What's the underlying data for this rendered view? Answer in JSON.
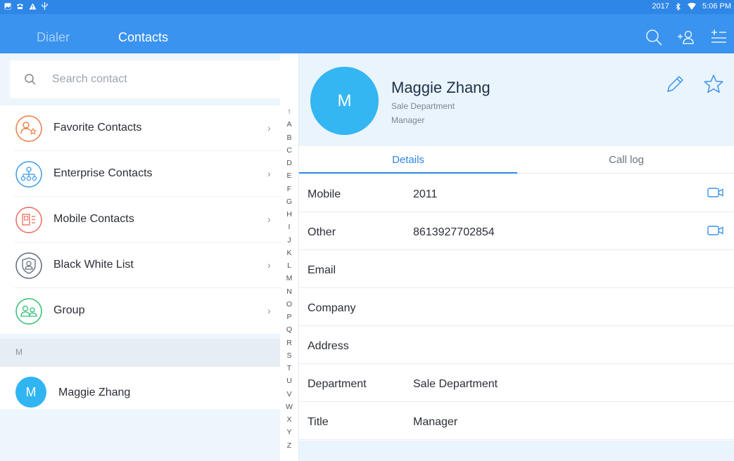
{
  "status_bar": {
    "left_icons": [
      "image-icon",
      "phone-icon",
      "warning-icon",
      "usb-icon"
    ],
    "year": "2017",
    "time": "5:06 PM"
  },
  "app_bar": {
    "tabs": [
      {
        "label": "Dialer",
        "active": false
      },
      {
        "label": "Contacts",
        "active": true
      }
    ],
    "icons": [
      "search-icon",
      "add-contact-icon",
      "menu-add-icon"
    ]
  },
  "search": {
    "placeholder": "Search contact"
  },
  "menu": [
    {
      "label": "Favorite Contacts",
      "icon": "favorite-contacts-icon",
      "color": "#f07b3f"
    },
    {
      "label": "Enterprise Contacts",
      "icon": "enterprise-contacts-icon",
      "color": "#3a9be8"
    },
    {
      "label": "Mobile Contacts",
      "icon": "mobile-contacts-icon",
      "color": "#ef6a5a"
    },
    {
      "label": "Black White List",
      "icon": "black-white-list-icon",
      "color": "#5d6b7a"
    },
    {
      "label": "Group",
      "icon": "group-icon",
      "color": "#2fbf71"
    }
  ],
  "section_letter": "M",
  "contact_list": [
    {
      "initial": "M",
      "name": "Maggie Zhang"
    }
  ],
  "alphabet": [
    "↑",
    "A",
    "B",
    "C",
    "D",
    "E",
    "F",
    "G",
    "H",
    "I",
    "J",
    "K",
    "L",
    "M",
    "N",
    "O",
    "P",
    "Q",
    "R",
    "S",
    "T",
    "U",
    "V",
    "W",
    "X",
    "Y",
    "Z"
  ],
  "detail": {
    "initial": "M",
    "name": "Maggie Zhang",
    "department": "Sale Department",
    "title": "Manager",
    "tabs": [
      "Details",
      "Call log"
    ],
    "fields": [
      {
        "label": "Mobile",
        "value": "2011",
        "video": true
      },
      {
        "label": "Other",
        "value": "8613927702854",
        "video": true
      },
      {
        "label": "Email",
        "value": "",
        "video": false
      },
      {
        "label": "Company",
        "value": "",
        "video": false
      },
      {
        "label": "Address",
        "value": "",
        "video": false
      },
      {
        "label": "Department",
        "value": "Sale Department",
        "video": false
      },
      {
        "label": "Title",
        "value": "Manager",
        "video": false
      }
    ]
  },
  "colors": {
    "status_bar": "#2e86e6",
    "app_bar": "#3a93ee",
    "accent": "#2e86e6",
    "avatar": "#33b6f2",
    "panel_bg": "#eef6fd"
  }
}
